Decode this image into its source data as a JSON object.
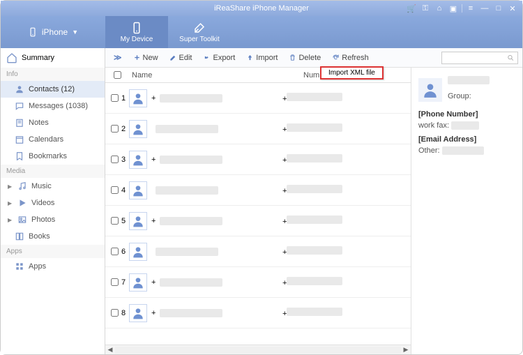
{
  "title": "iReaShare iPhone Manager",
  "device": {
    "name": "iPhone"
  },
  "nav": {
    "my_device": "My Device",
    "super_toolkit": "Super Toolkit"
  },
  "sidebar": {
    "summary": "Summary",
    "groups": {
      "info": "Info",
      "media": "Media",
      "apps": "Apps"
    },
    "items": {
      "contacts": "Contacts  (12)",
      "messages": "Messages  (1038)",
      "notes": "Notes",
      "calendars": "Calendars",
      "bookmarks": "Bookmarks",
      "music": "Music",
      "videos": "Videos",
      "photos": "Photos",
      "books": "Books",
      "apps": "Apps"
    }
  },
  "toolbar": {
    "expand": "≫",
    "new": "New",
    "edit": "Edit",
    "export": "Export",
    "import": "Import",
    "delete": "Delete",
    "refresh": "Refresh",
    "search_placeholder": ""
  },
  "import_menu": {
    "xml": "Import XML file"
  },
  "columns": {
    "name": "Name",
    "number": "Number"
  },
  "rows": [
    {
      "idx": "1",
      "name_prefix": "+"
    },
    {
      "idx": "2",
      "name_prefix": ""
    },
    {
      "idx": "3",
      "name_prefix": "+"
    },
    {
      "idx": "4",
      "name_prefix": ""
    },
    {
      "idx": "5",
      "name_prefix": "+"
    },
    {
      "idx": "6",
      "name_prefix": ""
    },
    {
      "idx": "7",
      "name_prefix": "+"
    },
    {
      "idx": "8",
      "name_prefix": "+"
    }
  ],
  "detail": {
    "group_label": "Group:",
    "phone_header": "[Phone Number]",
    "work_fax": "work fax:",
    "email_header": "[Email Address]",
    "other": "Other:"
  }
}
